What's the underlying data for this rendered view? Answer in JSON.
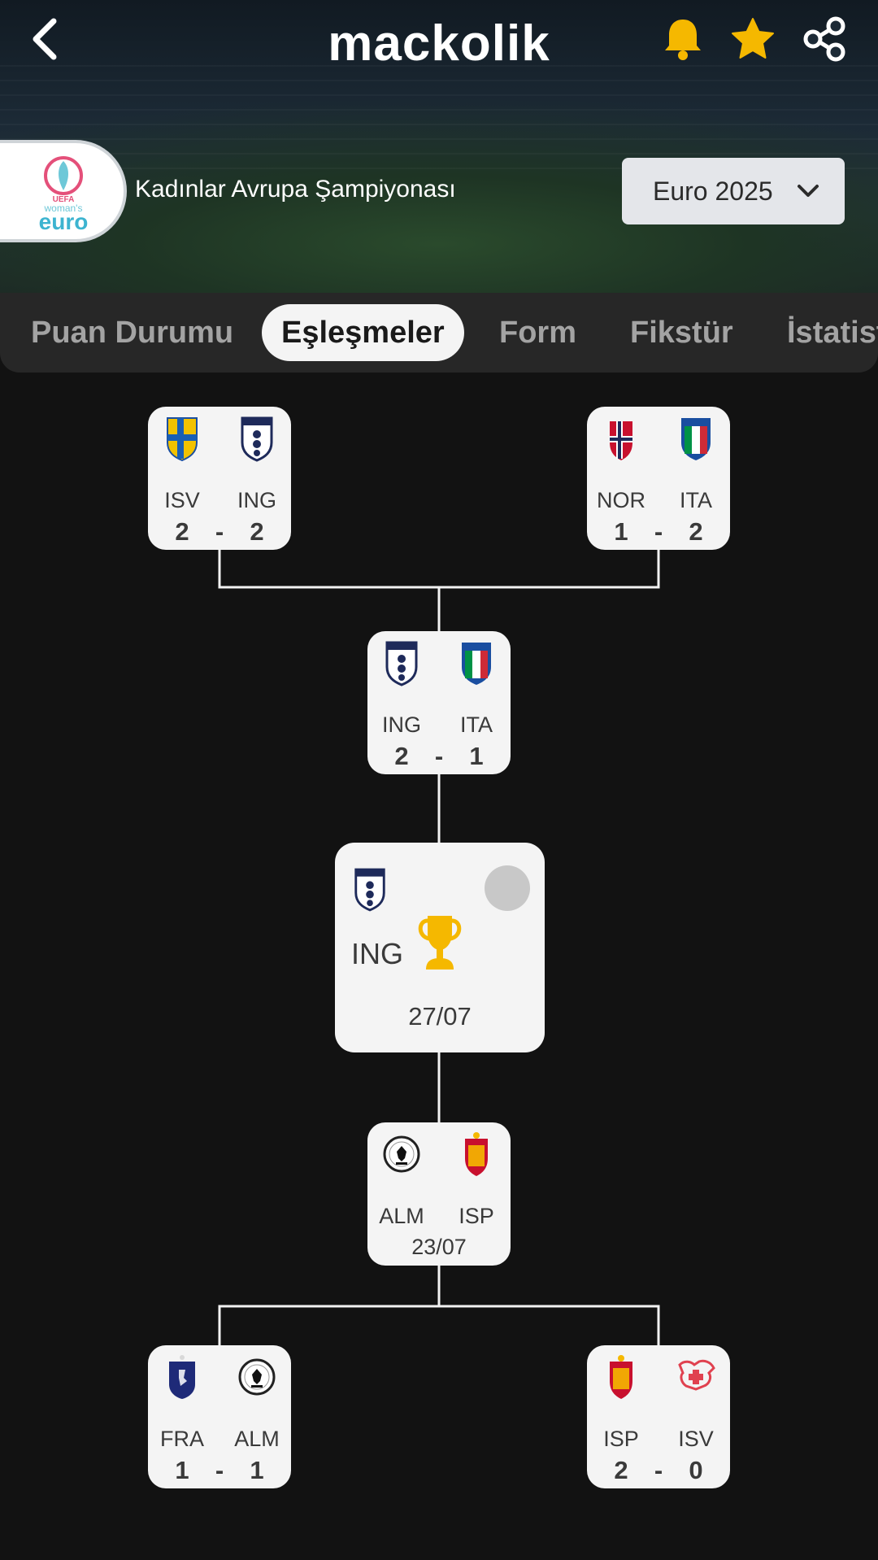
{
  "app": {
    "title": "mackolik"
  },
  "competition": {
    "name": "Kadınlar Avrupa Şampiyonası",
    "season": "Euro 2025"
  },
  "tabs": [
    "Puan Durumu",
    "Eşleşmeler",
    "Form",
    "Fikstür",
    "İstatist"
  ],
  "active_tab": "Eşleşmeler",
  "icons": {
    "back": "back-arrow-icon",
    "bell": "bell-icon",
    "star": "star-icon",
    "share": "share-icon",
    "dropdown": "chevron-down-icon",
    "trophy": "trophy-icon"
  },
  "colors": {
    "accent": "#F5B800",
    "card": "#F4F4F4",
    "background": "#121212",
    "tab_bar": "#272727"
  },
  "bracket": {
    "sf_top_left": {
      "home": "ISV",
      "away": "ING",
      "home_score": "2",
      "away_score": "2",
      "sep": "-"
    },
    "sf_top_right": {
      "home": "NOR",
      "away": "ITA",
      "home_score": "1",
      "away_score": "2",
      "sep": "-"
    },
    "semi_top": {
      "home": "ING",
      "away": "ITA",
      "home_score": "2",
      "away_score": "1",
      "sep": "-"
    },
    "final": {
      "team": "ING",
      "date": "27/07"
    },
    "semi_bottom": {
      "home": "ALM",
      "away": "ISP",
      "date": "23/07"
    },
    "qf_bottom_left": {
      "home": "FRA",
      "away": "ALM",
      "home_score": "1",
      "away_score": "1",
      "sep": "-"
    },
    "qf_bottom_right": {
      "home": "ISP",
      "away": "ISV",
      "home_score": "2",
      "away_score": "0",
      "sep": "-"
    }
  }
}
